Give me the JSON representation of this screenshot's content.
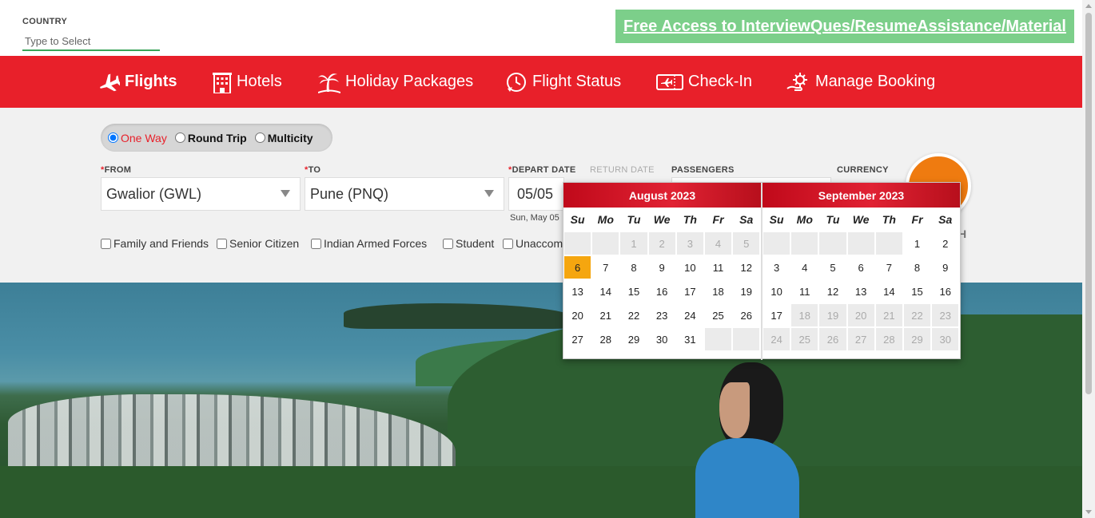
{
  "country": {
    "label": "COUNTRY",
    "placeholder": "Type to Select"
  },
  "promo": {
    "text": "Free Access to InterviewQues/ResumeAssistance/Material"
  },
  "nav": [
    {
      "label": "Flights",
      "icon": "airplane-icon"
    },
    {
      "label": "Hotels",
      "icon": "hotel-building-icon"
    },
    {
      "label": "Holiday Packages",
      "icon": "palm-tree-icon"
    },
    {
      "label": "Flight Status",
      "icon": "clock-icon"
    },
    {
      "label": "Check-In",
      "icon": "ticket-icon"
    },
    {
      "label": "Manage Booking",
      "icon": "gear-hand-icon"
    }
  ],
  "trip_types": [
    {
      "label": "One Way",
      "selected": true
    },
    {
      "label": "Round Trip",
      "selected": false
    },
    {
      "label": "Multicity",
      "selected": false
    }
  ],
  "form": {
    "from_label": "FROM",
    "from_value": "Gwalior (GWL)",
    "to_label": "TO",
    "to_value": "Pune (PNQ)",
    "depart_label": "DEPART DATE",
    "depart_value": "05/05",
    "depart_sub": "Sun, May 05",
    "return_label": "RETURN DATE",
    "passengers_label": "PASSENGERS",
    "currency_label": "CURRENCY",
    "search_partial": "H"
  },
  "discounts": [
    "Family and Friends",
    "Senior Citizen",
    "Indian Armed Forces",
    "Student",
    "Unaccom"
  ],
  "calendar": {
    "weekdays": [
      "Su",
      "Mo",
      "Tu",
      "We",
      "Th",
      "Fr",
      "Sa"
    ],
    "months": [
      {
        "title": "August 2023",
        "cells": [
          {
            "d": "",
            "s": "empty"
          },
          {
            "d": "",
            "s": "empty"
          },
          {
            "d": "1",
            "s": "disabled"
          },
          {
            "d": "2",
            "s": "disabled"
          },
          {
            "d": "3",
            "s": "disabled"
          },
          {
            "d": "4",
            "s": "disabled"
          },
          {
            "d": "5",
            "s": "disabled"
          },
          {
            "d": "6",
            "s": "today"
          },
          {
            "d": "7",
            "s": ""
          },
          {
            "d": "8",
            "s": ""
          },
          {
            "d": "9",
            "s": ""
          },
          {
            "d": "10",
            "s": ""
          },
          {
            "d": "11",
            "s": ""
          },
          {
            "d": "12",
            "s": ""
          },
          {
            "d": "13",
            "s": ""
          },
          {
            "d": "14",
            "s": ""
          },
          {
            "d": "15",
            "s": ""
          },
          {
            "d": "16",
            "s": ""
          },
          {
            "d": "17",
            "s": ""
          },
          {
            "d": "18",
            "s": ""
          },
          {
            "d": "19",
            "s": ""
          },
          {
            "d": "20",
            "s": ""
          },
          {
            "d": "21",
            "s": ""
          },
          {
            "d": "22",
            "s": ""
          },
          {
            "d": "23",
            "s": ""
          },
          {
            "d": "24",
            "s": ""
          },
          {
            "d": "25",
            "s": ""
          },
          {
            "d": "26",
            "s": ""
          },
          {
            "d": "27",
            "s": ""
          },
          {
            "d": "28",
            "s": ""
          },
          {
            "d": "29",
            "s": ""
          },
          {
            "d": "30",
            "s": ""
          },
          {
            "d": "31",
            "s": ""
          },
          {
            "d": "",
            "s": "empty"
          },
          {
            "d": "",
            "s": "empty"
          }
        ]
      },
      {
        "title": "September 2023",
        "cells": [
          {
            "d": "",
            "s": "empty"
          },
          {
            "d": "",
            "s": "empty"
          },
          {
            "d": "",
            "s": "empty"
          },
          {
            "d": "",
            "s": "empty"
          },
          {
            "d": "",
            "s": "empty"
          },
          {
            "d": "1",
            "s": ""
          },
          {
            "d": "2",
            "s": ""
          },
          {
            "d": "3",
            "s": ""
          },
          {
            "d": "4",
            "s": ""
          },
          {
            "d": "5",
            "s": ""
          },
          {
            "d": "6",
            "s": ""
          },
          {
            "d": "7",
            "s": ""
          },
          {
            "d": "8",
            "s": ""
          },
          {
            "d": "9",
            "s": ""
          },
          {
            "d": "10",
            "s": ""
          },
          {
            "d": "11",
            "s": ""
          },
          {
            "d": "12",
            "s": ""
          },
          {
            "d": "13",
            "s": ""
          },
          {
            "d": "14",
            "s": ""
          },
          {
            "d": "15",
            "s": ""
          },
          {
            "d": "16",
            "s": ""
          },
          {
            "d": "17",
            "s": ""
          },
          {
            "d": "18",
            "s": "disabled"
          },
          {
            "d": "19",
            "s": "disabled"
          },
          {
            "d": "20",
            "s": "disabled"
          },
          {
            "d": "21",
            "s": "disabled"
          },
          {
            "d": "22",
            "s": "disabled"
          },
          {
            "d": "23",
            "s": "disabled"
          },
          {
            "d": "24",
            "s": "disabled"
          },
          {
            "d": "25",
            "s": "disabled"
          },
          {
            "d": "26",
            "s": "disabled"
          },
          {
            "d": "27",
            "s": "disabled"
          },
          {
            "d": "28",
            "s": "disabled"
          },
          {
            "d": "29",
            "s": "disabled"
          },
          {
            "d": "30",
            "s": "disabled"
          }
        ]
      }
    ]
  },
  "colors": {
    "brand_red": "#e8202a",
    "promo_green": "#7ccf8a",
    "today_orange": "#f5a60f",
    "search_orange": "#ef7b10"
  }
}
